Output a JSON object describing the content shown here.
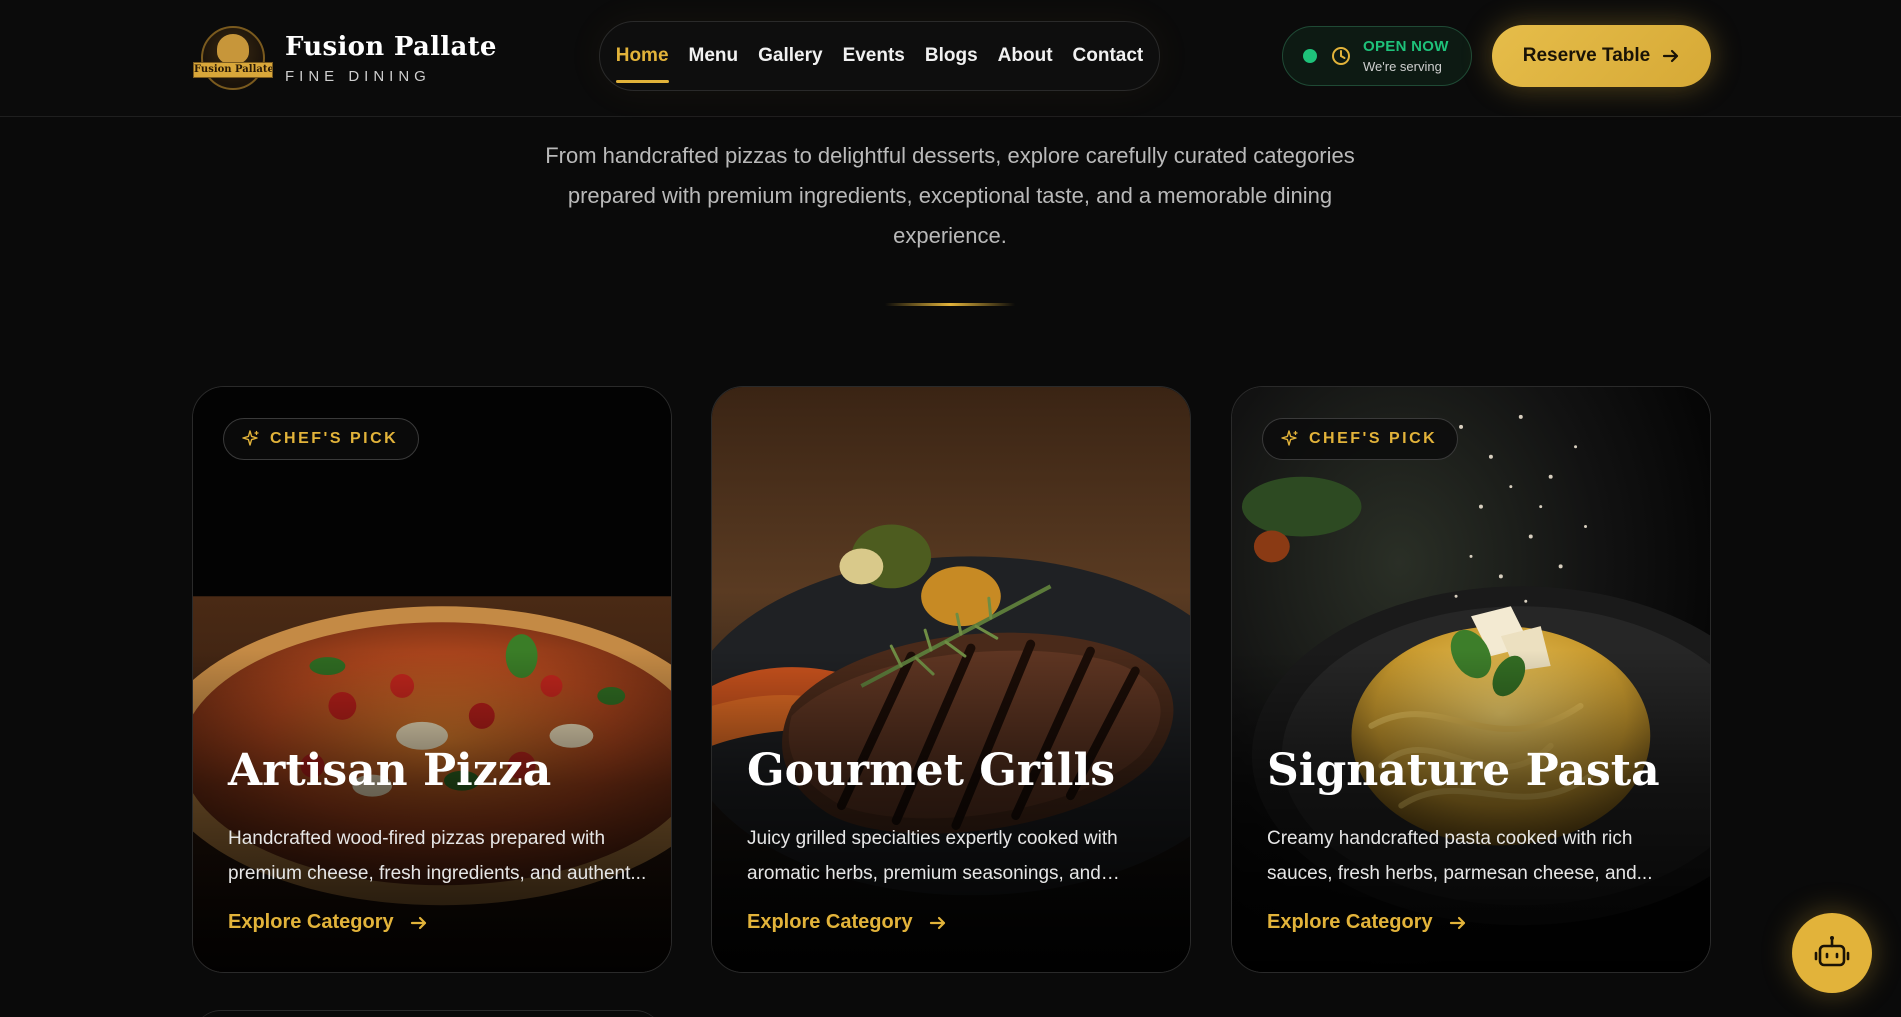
{
  "header": {
    "brand": {
      "name": "Fusion Pallate",
      "subtitle": "FINE DINING",
      "logo_text": "Fusion Pallate"
    },
    "nav": [
      {
        "label": "Home",
        "active": true
      },
      {
        "label": "Menu",
        "active": false
      },
      {
        "label": "Gallery",
        "active": false
      },
      {
        "label": "Events",
        "active": false
      },
      {
        "label": "Blogs",
        "active": false
      },
      {
        "label": "About",
        "active": false
      },
      {
        "label": "Contact",
        "active": false
      }
    ],
    "status": {
      "title": "OPEN NOW",
      "subtitle": "We're serving",
      "color": "#1ec27a"
    },
    "reserve_label": "Reserve Table"
  },
  "intro": {
    "text": "From handcrafted pizzas to delightful desserts, explore carefully curated categories prepared with premium ingredients, exceptional taste, and a memorable dining experience."
  },
  "cards": [
    {
      "badge": "CHEF'S PICK",
      "title": "Artisan Pizza",
      "description": "Handcrafted wood-fired pizzas prepared with premium cheese, fresh ingredients, and authent...",
      "link": "Explore Category"
    },
    {
      "badge": "",
      "title": "Gourmet Grills",
      "description": "Juicy grilled specialties expertly cooked with aromatic herbs, premium seasonings, and serve...",
      "link": "Explore Category"
    },
    {
      "badge": "CHEF'S PICK",
      "title": "Signature Pasta",
      "description": "Creamy handcrafted pasta cooked with rich sauces, fresh herbs, parmesan cheese, and...",
      "link": "Explore Category"
    }
  ],
  "colors": {
    "accent": "#e2b33a",
    "background": "#0a0a0a",
    "status_green": "#1ec27a"
  },
  "icons": {
    "status_dot": "status-dot-icon",
    "clock": "clock-icon",
    "arrow": "arrow-right-icon",
    "sparkle": "sparkle-icon",
    "bot": "robot-icon"
  }
}
